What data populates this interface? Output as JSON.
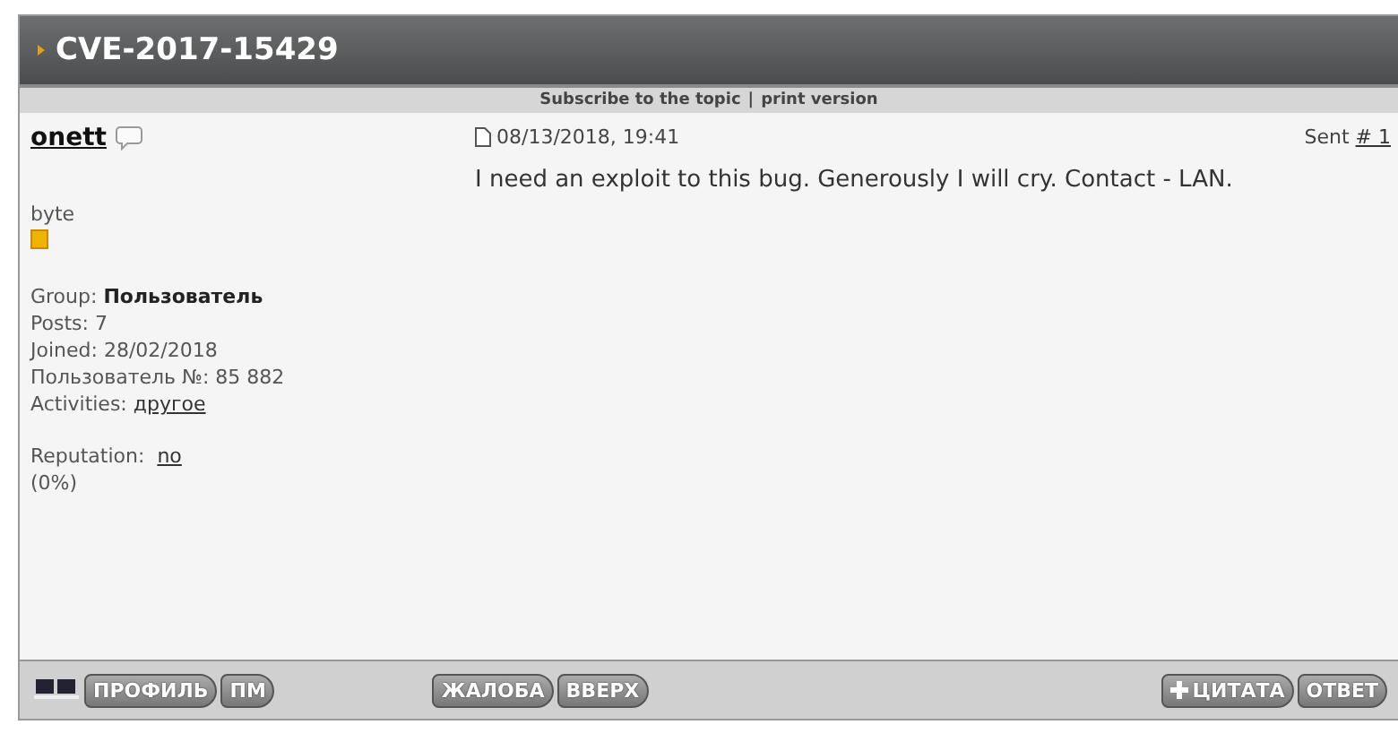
{
  "topic": {
    "title": "CVE-2017-15429"
  },
  "topic_links": [
    {
      "label": "Subscribe to the topic"
    },
    {
      "label": "print version"
    }
  ],
  "separator": "|",
  "author": {
    "name": "onett",
    "rank": "byte",
    "details": [
      {
        "label": "Group:",
        "value": "Пользователь",
        "kind": "bold"
      },
      {
        "label": "Posts:",
        "value": "7",
        "kind": "plain"
      },
      {
        "label": "Joined:",
        "value": "28/02/2018",
        "kind": "plain"
      },
      {
        "label": "Пользователь №:",
        "value": "85 882",
        "kind": "plain"
      },
      {
        "label": "Activities:",
        "value": "другое",
        "kind": "link"
      }
    ],
    "reputation_label": "Reputation:",
    "reputation_value": "no",
    "reputation_percent": "(0%)"
  },
  "post": {
    "date": "08/13/2018, 19:41",
    "sent_label": "Sent",
    "post_number": "# 1",
    "body": "I need an exploit to this bug. Generously I will cry. Contact - LAN."
  },
  "footer": {
    "left_buttons": [
      "ПРОФИЛЬ",
      "ПМ"
    ],
    "middle_buttons": [
      "ЖАЛОБА",
      "ВВЕРХ"
    ],
    "right_buttons": [
      {
        "label": "ЦИТАТА",
        "kind": "plus"
      },
      {
        "label": "ОТВЕТ",
        "kind": "plain"
      }
    ]
  }
}
